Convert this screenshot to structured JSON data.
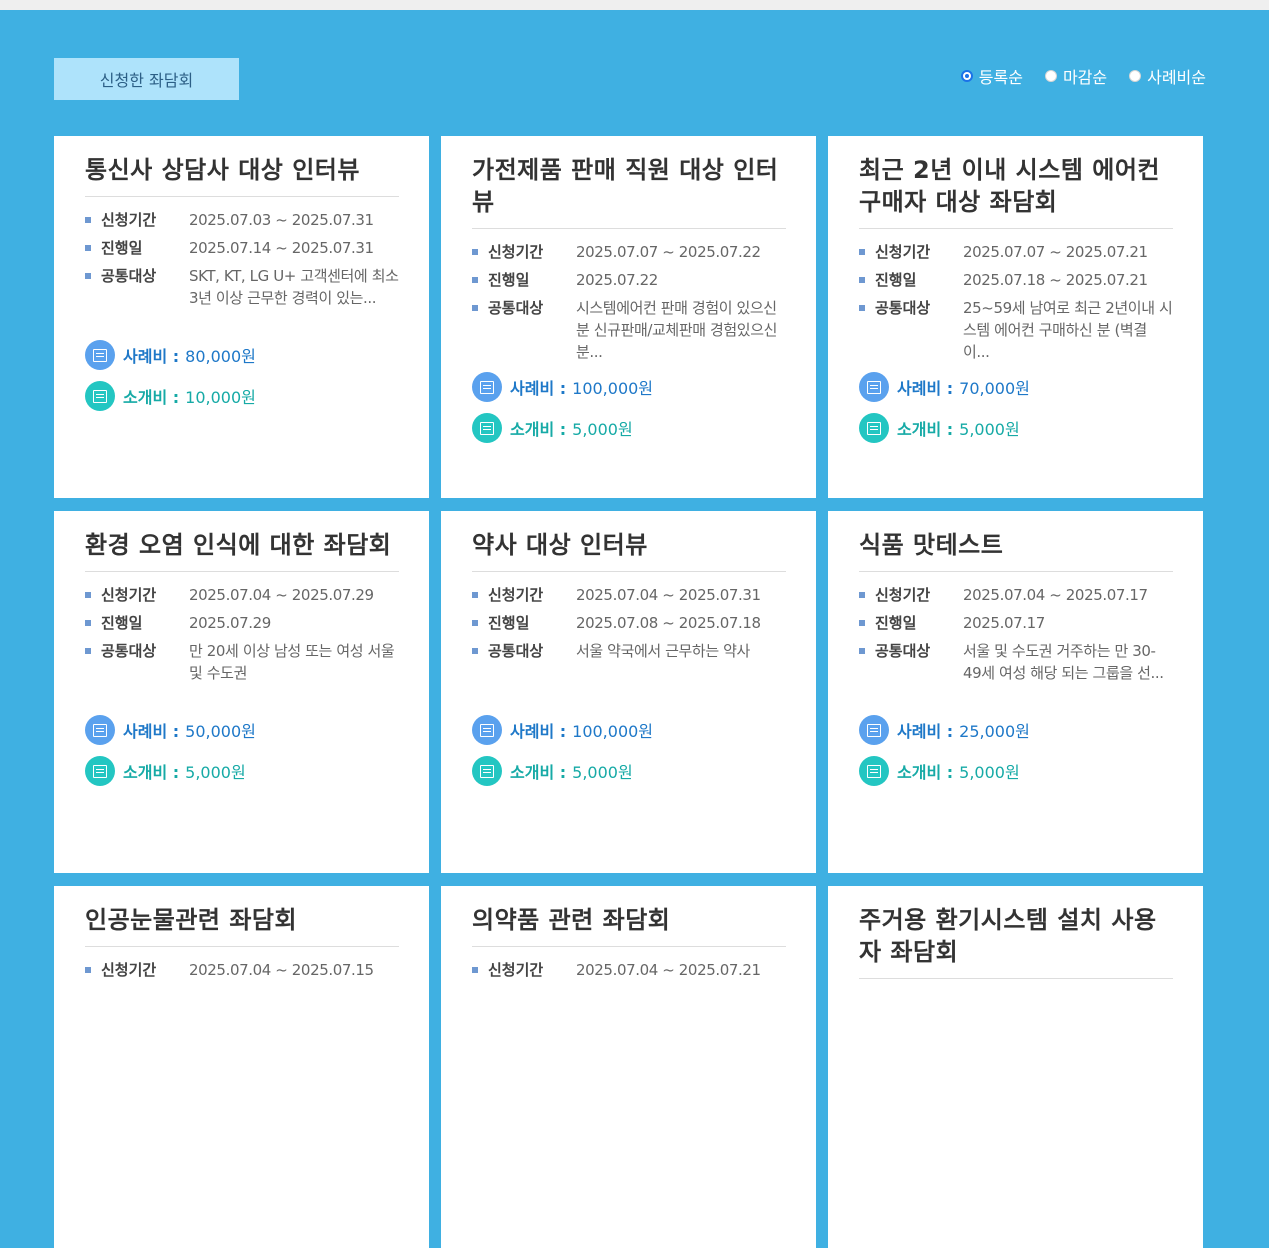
{
  "header": {
    "applied_button": "신청한 좌담회",
    "sort_options": [
      {
        "label": "등록순",
        "selected": true
      },
      {
        "label": "마감순",
        "selected": false
      },
      {
        "label": "사례비순",
        "selected": false
      }
    ]
  },
  "labels": {
    "period": "신청기간",
    "date": "진행일",
    "target": "공통대상",
    "pay": "사례비 :",
    "referral": "소개비 :"
  },
  "cards": [
    {
      "title": "통신사 상담사 대상 인터뷰",
      "period": "2025.07.03 ~ 2025.07.31",
      "date": "2025.07.14 ~ 2025.07.31",
      "target": "SKT, KT, LG U+ 고객센터에 최소 3년 이상 근무한 경력이 있는...",
      "pay": "80,000원",
      "referral": "10,000원"
    },
    {
      "title": "가전제품 판매 직원 대상 인터뷰",
      "period": "2025.07.07 ~ 2025.07.22",
      "date": "2025.07.22",
      "target": "시스템에어컨 판매 경험이 있으신 분 신규판매/교체판매 경험있으신 분...",
      "pay": "100,000원",
      "referral": "5,000원"
    },
    {
      "title": "최근 2년 이내 시스템 에어컨 구매자 대상 좌담회",
      "period": "2025.07.07 ~ 2025.07.21",
      "date": "2025.07.18 ~ 2025.07.21",
      "target": "25~59세 남여로 최근 2년이내 시스템 에어컨 구매하신 분 (벽결이...",
      "pay": "70,000원",
      "referral": "5,000원"
    },
    {
      "title": "환경 오염 인식에 대한 좌담회",
      "period": "2025.07.04 ~ 2025.07.29",
      "date": "2025.07.29",
      "target": "만 20세 이상 남성 또는 여성 서울 및 수도권",
      "pay": "50,000원",
      "referral": "5,000원"
    },
    {
      "title": "약사 대상 인터뷰",
      "period": "2025.07.04 ~ 2025.07.31",
      "date": "2025.07.08 ~ 2025.07.18",
      "target": "서울 약국에서 근무하는 약사",
      "pay": "100,000원",
      "referral": "5,000원"
    },
    {
      "title": "식품 맛테스트",
      "period": "2025.07.04 ~ 2025.07.17",
      "date": "2025.07.17",
      "target": "서울 및 수도권 거주하는 만 30-49세 여성 해당 되는 그룹을 선...",
      "pay": "25,000원",
      "referral": "5,000원"
    },
    {
      "title": "인공눈물관련 좌담회",
      "period": "2025.07.04 ~ 2025.07.15"
    },
    {
      "title": "의약품 관련 좌담회",
      "period": "2025.07.04 ~ 2025.07.21"
    },
    {
      "title": "주거용 환기시스템 설치 사용자 좌담회"
    }
  ]
}
